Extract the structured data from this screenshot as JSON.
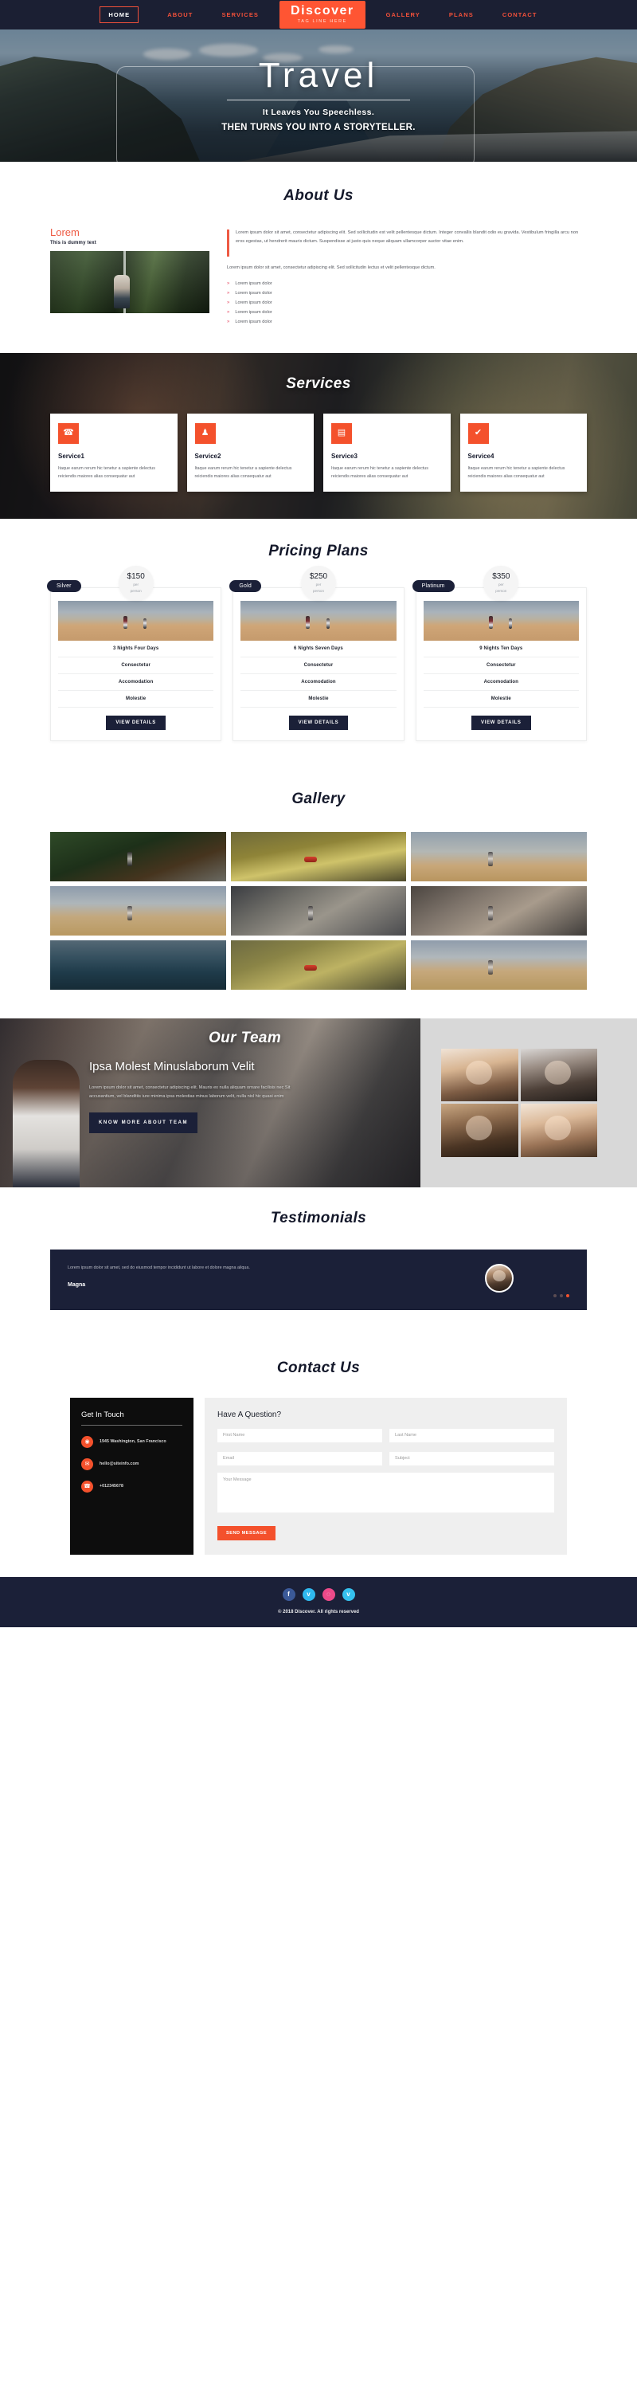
{
  "nav": {
    "logo": {
      "name": "Discover",
      "tagline": "TAG LINE HERE"
    },
    "items": [
      {
        "label": "HOME",
        "active": true
      },
      {
        "label": "ABOUT",
        "active": false
      },
      {
        "label": "SERVICES",
        "active": false
      },
      {
        "label": "GALLERY",
        "active": false
      },
      {
        "label": "PLANS",
        "active": false
      },
      {
        "label": "CONTACT",
        "active": false
      }
    ]
  },
  "hero": {
    "title": "Travel",
    "subtitle1": "It Leaves You Speechless.",
    "subtitle2": "THEN TURNS YOU INTO A STORYTELLER."
  },
  "about": {
    "heading": "About Us",
    "lorem_title": "Lorem",
    "lorem_sub": "This is dummy text",
    "paragraph1": "Lorem ipsum dolor sit amet, consectetur adipiscing elit. Sed sollicitudin est velit pellentesque dictum. Integer convallis blandit odio eu gravida. Vestibulum fringilla arcu non eros egestas, ut hendrerit mauris dictum. Suspendisse at justo quis neque aliquam ullamcorper auctor vitae enim.",
    "paragraph2": "Lorem ipsum dolor sit amet, consectetur adipiscing elit. Sed sollicitudin lectus et velit pellentesque dictum.",
    "list": [
      "Lorem ipsum dolor",
      "Lorem ipsum dolor",
      "Lorem ipsum dolor",
      "Lorem ipsum dolor",
      "Lorem ipsum dolor"
    ]
  },
  "services": {
    "heading": "Services",
    "cards": [
      {
        "icon": "phone-icon",
        "glyph": "☎",
        "title": "Service1",
        "desc": "Itaque earum rerum hic tenetur a sapiente delectus reiciendis maiores alias consequatur aut"
      },
      {
        "icon": "user-icon",
        "glyph": "♟",
        "title": "Service2",
        "desc": "Itaque earum rerum hic tenetur a sapiente delectus reiciendis maiores alias consequatur aut"
      },
      {
        "icon": "id-card-icon",
        "glyph": "▤",
        "title": "Service3",
        "desc": "Itaque earum rerum hic tenetur a sapiente delectus reiciendis maiores alias consequatur aut"
      },
      {
        "icon": "check-icon",
        "glyph": "✔",
        "title": "Service4",
        "desc": "Itaque earum rerum hic tenetur a sapiente delectus reiciendis maiores alias consequatur aut"
      }
    ]
  },
  "pricing": {
    "heading": "Pricing Plans",
    "per_label_line1": "per",
    "per_label_line2": "person",
    "button_label": "VIEW DETAILS",
    "plans": [
      {
        "badge": "Silver",
        "price": "$150",
        "features": [
          "3 Nights Four Days",
          "Consectetur",
          "Accomodation",
          "Molestie"
        ]
      },
      {
        "badge": "Gold",
        "price": "$250",
        "features": [
          "6 Nights Seven Days",
          "Consectetur",
          "Accomodation",
          "Molestie"
        ]
      },
      {
        "badge": "Platinum",
        "price": "$350",
        "features": [
          "9 Nights Ten Days",
          "Consectetur",
          "Accomodation",
          "Molestie"
        ]
      }
    ]
  },
  "gallery": {
    "heading": "Gallery",
    "items": [
      "gallery-image-1",
      "gallery-image-2",
      "gallery-image-3",
      "gallery-image-4",
      "gallery-image-5",
      "gallery-image-6",
      "gallery-image-7",
      "gallery-image-8",
      "gallery-image-9"
    ]
  },
  "team": {
    "heading": "Our Team",
    "title": "Ipsa Molest Minuslaborum Velit",
    "paragraph": "Lorem ipsum dolor sit amet, consectetur adipiscing elit. Mauris ex nulla aliquam ornare facilisis nec Sit accusantium, vel blanditiis iure minima ipsa molestias minus laborum velit, nulla nisl hic quasi enim",
    "button_label": "KNOW MORE ABOUT TEAM",
    "photos": [
      "team-photo-1",
      "team-photo-2",
      "team-photo-3",
      "team-photo-4"
    ]
  },
  "testimonials": {
    "heading": "Testimonials",
    "quote": "Lorem ipsum dolor sit amet, sed do eiusmod tempor incididunt ut labore et dolore magna aliqua.",
    "author": "Magna",
    "dots": [
      false,
      false,
      true
    ]
  },
  "contact": {
    "heading": "Contact Us",
    "get_in_touch": {
      "title": "Get In Touch",
      "rows": [
        {
          "icon": "location-pin-icon",
          "glyph": "◉",
          "text": "1945 Washington, San Francisco"
        },
        {
          "icon": "envelope-icon",
          "glyph": "✉",
          "text": "hello@siteinfo.com"
        },
        {
          "icon": "phone-icon",
          "glyph": "☎",
          "text": "+012345678"
        }
      ]
    },
    "form": {
      "title": "Have A Question?",
      "first_name_placeholder": "First Name",
      "last_name_placeholder": "Last Name",
      "email_placeholder": "Email",
      "subject_placeholder": "Subject",
      "message_placeholder": "Your Message",
      "submit_label": "SEND MESSAGE",
      "first_name_value": "",
      "last_name_value": "",
      "email_value": "",
      "subject_value": "",
      "message_value": ""
    }
  },
  "footer": {
    "social": [
      {
        "name": "facebook-icon",
        "glyph": "f",
        "color": "#3b5998"
      },
      {
        "name": "twitter-icon",
        "glyph": "ᴠ",
        "color": "#2fb9ef"
      },
      {
        "name": "dribbble-icon",
        "glyph": "◌",
        "color": "#ec4a89"
      },
      {
        "name": "vimeo-icon",
        "glyph": "v",
        "color": "#35c1ee"
      }
    ],
    "copyright": "© 2018 Discover. All rights reserved"
  },
  "colors": {
    "accent": "#f4512c",
    "dark": "#1b2038",
    "nav_bg": "#1b1f33"
  }
}
